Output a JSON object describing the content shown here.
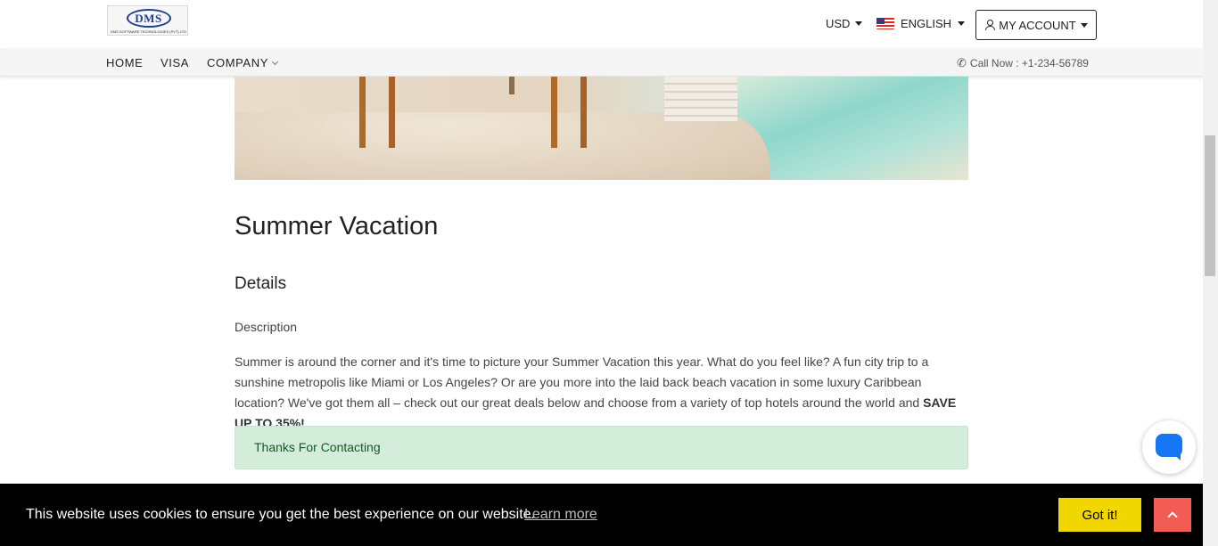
{
  "header": {
    "logo": {
      "brand": "DMS",
      "subtitle": "DMS SOFTWARE TECHNOLOGIES (PVT) LTD"
    },
    "currency": "USD",
    "language": "ENGLISH",
    "account_label": "MY ACCOUNT"
  },
  "nav": {
    "items": [
      {
        "label": "HOME"
      },
      {
        "label": "VISA"
      },
      {
        "label": "COMPANY"
      }
    ],
    "call_text": "Call Now : +1-234-56789"
  },
  "content": {
    "title": "Summer Vacation",
    "subtitle": "Details",
    "description_label": "Description",
    "description_text": "Summer is around the corner and it's time to picture your Summer Vacation this year. What do you feel like? A fun city trip to a sunshine metropolis like Miami or Los Angeles? Or are you more into the laid back beach vacation in some luxury Caribbean location? We've got them all – check out our great deals below and choose from a variety of top hotels around the world and ",
    "description_bold": "SAVE UP TO 35%!",
    "alert_text": "Thanks For Contacting"
  },
  "cookie": {
    "message": "This website uses cookies to ensure you get the best experience on our website.",
    "learn_more": "Learn more",
    "button": "Got it!"
  },
  "colors": {
    "alert_bg": "#d4edda",
    "alert_text": "#155724",
    "cookie_button": "#f1d600",
    "scroll_top_button": "#f25c54",
    "chat_icon": "#1676f3"
  }
}
